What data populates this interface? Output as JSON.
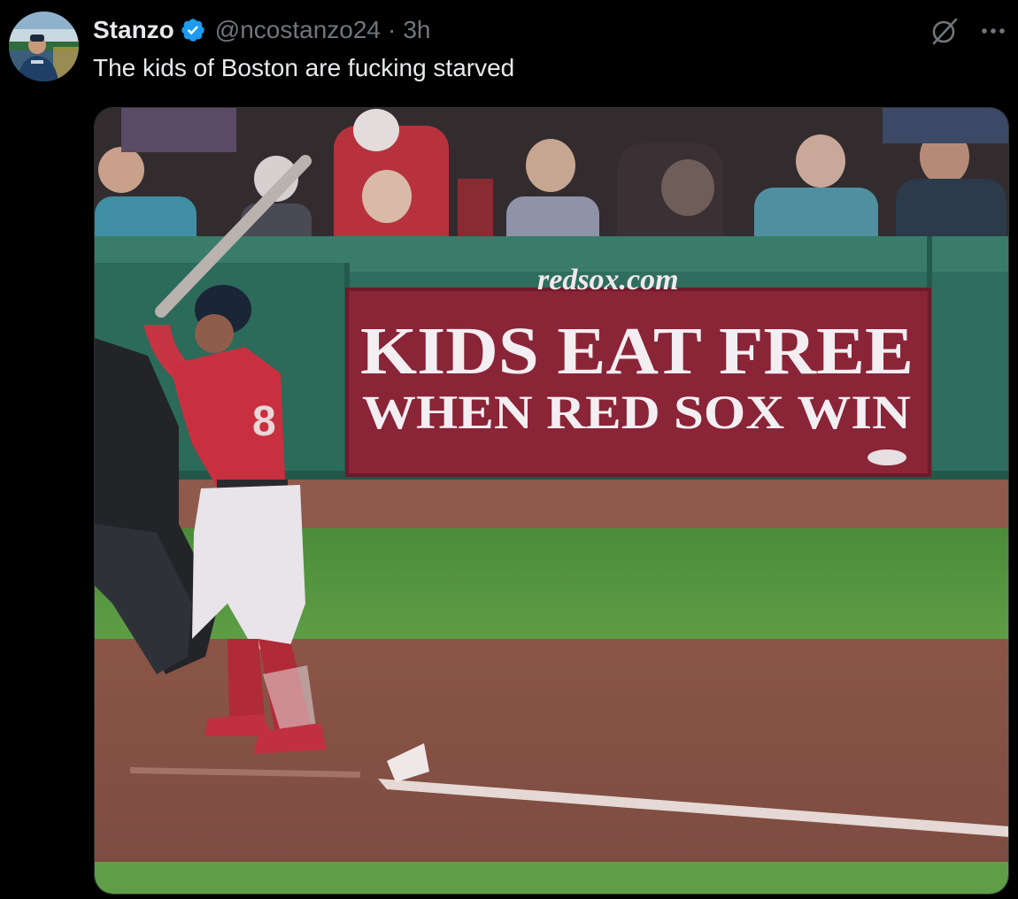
{
  "post": {
    "author": {
      "display_name": "Stanzo",
      "handle": "@ncostanzo24",
      "separator": "·",
      "time": "3h",
      "verified": true,
      "verified_color": "#1d9bf0"
    },
    "text": "The kids of Boston are fucking starved",
    "actions": {
      "grok_icon": "grok-icon",
      "more_icon": "more-icon"
    }
  },
  "media": {
    "ad_board": {
      "url_text": "redsox.com",
      "line1": "KIDS EAT FREE",
      "line2": "WHEN RED SOX WIN"
    },
    "player_number": "8"
  },
  "colors": {
    "background": "#000000",
    "text_primary": "#e7e9ea",
    "text_secondary": "#71767b",
    "ad_board": "#8a2437",
    "wall": "#2f6e5e"
  }
}
